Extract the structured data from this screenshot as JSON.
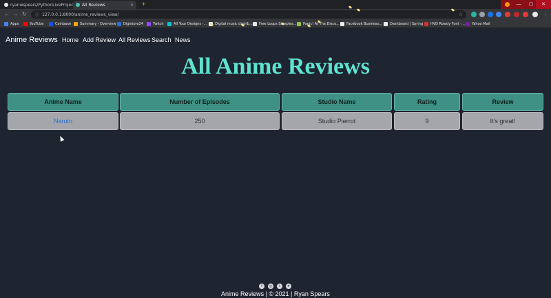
{
  "browser": {
    "tabs": [
      {
        "title": "ryanwspears/PythonLiveProject",
        "favicon_color": "#e8eaed"
      },
      {
        "title": "All Reviews",
        "favicon_color": "#4ac2b0"
      }
    ],
    "url": "127.0.0.1:8000/anime_reviews_view/",
    "bookmarks": [
      {
        "label": "Apps",
        "color": "#4285f4"
      },
      {
        "label": "YouTube",
        "color": "#ff0000"
      },
      {
        "label": "Coinbase",
        "color": "#1652f0"
      },
      {
        "label": "Summary - Overview",
        "color": "#f6a000"
      },
      {
        "label": "Digistore24",
        "color": "#2b6fd6"
      },
      {
        "label": "Twitch",
        "color": "#9146ff"
      },
      {
        "label": "All Your Designs -...",
        "color": "#00c4cc"
      },
      {
        "label": "Digital music distrib...",
        "color": "#e8eaed"
      },
      {
        "label": "Free Loops Samples...",
        "color": "#e8eaed"
      },
      {
        "label": "Panic! At The Disco...",
        "color": "#8bc34a"
      },
      {
        "label": "Facebook Business...",
        "color": "#e8eaed"
      },
      {
        "label": "Dashboard | Spring",
        "color": "#e8eaed"
      },
      {
        "label": "HVD Rowdy Font -...",
        "color": "#d32f2f"
      },
      {
        "label": "Yahoo Mail",
        "color": "#7b1fa2"
      }
    ]
  },
  "nav": {
    "brand": "Anime Reviews",
    "links": [
      "Home",
      "Add Review",
      "All Reviews",
      "Search",
      "News"
    ]
  },
  "page": {
    "title": "All Anime Reviews"
  },
  "table": {
    "headers": [
      "Anime Name",
      "Number of Episodes",
      "Studio Name",
      "Rating",
      "Review"
    ],
    "rows": [
      [
        "Naruto",
        "250",
        "Studio Pierrot",
        "9",
        "It's great!"
      ]
    ]
  },
  "footer": {
    "text": "Anime Reviews | © 2021 | Ryan Spears",
    "icons": [
      "facebook-icon",
      "instagram-icon",
      "twitter-icon",
      "telegram-icon"
    ]
  },
  "colors": {
    "background": "#1e2430",
    "heading": "#5ee3d0",
    "header_cell": "#3e9184",
    "body_cell": "#a4a6ab",
    "link": "#2e6fcc"
  }
}
